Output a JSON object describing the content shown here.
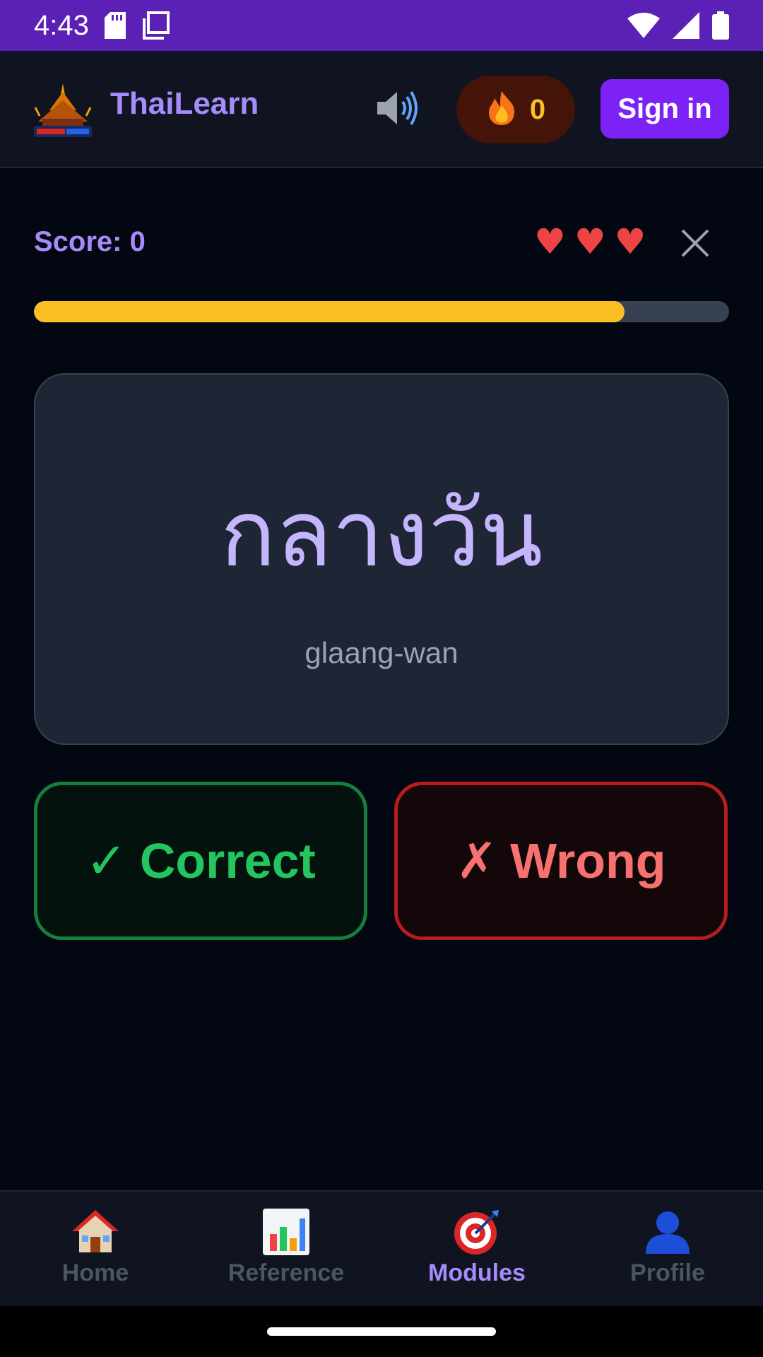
{
  "status_bar": {
    "time": "4:43"
  },
  "header": {
    "brand": "ThaiLearn",
    "streak_count": "0",
    "signin_label": "Sign in"
  },
  "quiz": {
    "score_label": "Score: 0",
    "lives": [
      "♥",
      "♥",
      "♥"
    ],
    "progress_fraction": 0.85
  },
  "card": {
    "thai_word": "กลางวัน",
    "transliteration": "glaang-wan"
  },
  "answers": {
    "correct_mark": "✓",
    "correct_label": "Correct",
    "wrong_mark": "✗",
    "wrong_label": "Wrong"
  },
  "nav": {
    "items": [
      {
        "label": "Home",
        "icon": "home-icon",
        "active": false
      },
      {
        "label": "Reference",
        "icon": "chart-icon",
        "active": false
      },
      {
        "label": "Modules",
        "icon": "target-icon",
        "active": true
      },
      {
        "label": "Profile",
        "icon": "person-icon",
        "active": false
      }
    ]
  },
  "colors": {
    "accent": "#a78bfa",
    "status_bar": "#5b21b6",
    "progress": "#fbbf24",
    "correct": "#22c55e",
    "wrong": "#f87171"
  }
}
